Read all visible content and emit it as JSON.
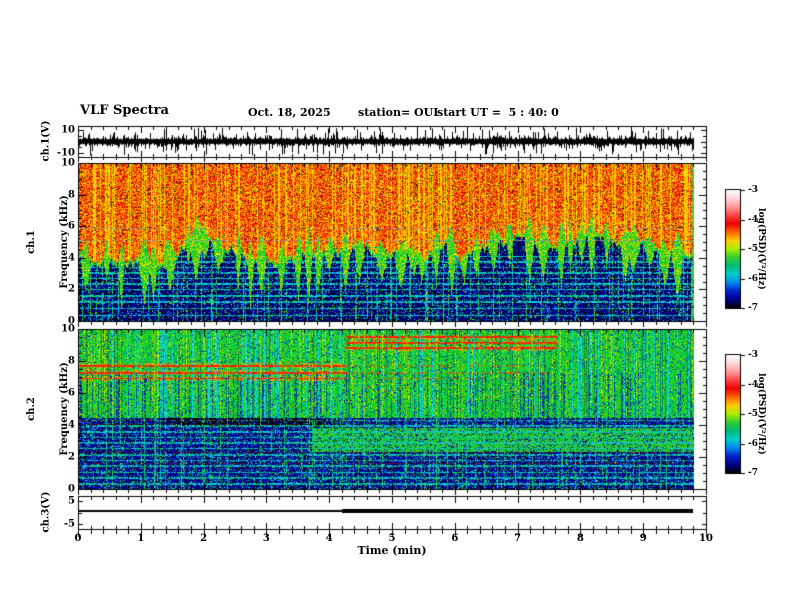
{
  "header": {
    "title": "VLF Spectra",
    "date": "Oct. 18, 2025",
    "station": "station= OUI",
    "start_ut": "start UT =  5 : 40: 0"
  },
  "time_axis": {
    "label": "Time (min)",
    "ticks": [
      "0",
      "1",
      "2",
      "3",
      "4",
      "5",
      "6",
      "7",
      "8",
      "9",
      "10"
    ],
    "range_min": [
      0,
      10
    ]
  },
  "panels": {
    "ch1_strip": {
      "ylabel": "ch.1(V)",
      "tick_labels": [
        "10",
        "-10"
      ],
      "ylim": [
        -10,
        10
      ]
    },
    "ch1_spec": {
      "ylabel_line1": "ch.1",
      "ylabel_line2": "Frequency (kHz)",
      "tick_labels": [
        "10",
        "8",
        "6",
        "4",
        "2",
        "0"
      ],
      "ylim_khz": [
        0,
        10
      ]
    },
    "ch2_spec": {
      "ylabel_line1": "ch.2",
      "ylabel_line2": "Frequency (kHz)",
      "tick_labels": [
        "10",
        "8",
        "6",
        "4",
        "2",
        "0"
      ],
      "ylim_khz": [
        0,
        10
      ]
    },
    "ch3_strip": {
      "ylabel": "ch.3(V)",
      "tick_labels": [
        "5",
        "-5"
      ],
      "ylim": [
        -5,
        5
      ]
    }
  },
  "colorbars": [
    {
      "label": "log(PSD)(V²/Hz)",
      "tick_labels": [
        "-3",
        "-4",
        "-5",
        "-6",
        "-7"
      ],
      "value_range": [
        -7,
        -3
      ],
      "gradient_top_to_bottom": [
        "#ffffff",
        "#ffd6da",
        "#ff9a9a",
        "#ff4444",
        "#ee0000",
        "#ff6600",
        "#ffcc00",
        "#aaee00",
        "#33cc33",
        "#00bb77",
        "#00cccc",
        "#0088ee",
        "#0022cc",
        "#000088",
        "#000000"
      ]
    },
    {
      "label": "log(PSD)(V²/Hz)",
      "tick_labels": [
        "-3",
        "-4",
        "-5",
        "-6",
        "-7"
      ],
      "value_range": [
        -7,
        -3
      ],
      "gradient_top_to_bottom": [
        "#ffffff",
        "#ffd6da",
        "#ff9a9a",
        "#ff4444",
        "#ee0000",
        "#ff6600",
        "#ffcc00",
        "#aaee00",
        "#33cc33",
        "#00bb77",
        "#00cccc",
        "#0088ee",
        "#0022cc",
        "#000088",
        "#000000"
      ]
    }
  ],
  "chart_data": [
    {
      "type": "line",
      "panel": "ch1_waveform",
      "ylabel": "ch.1(V)",
      "ylim": [
        -10,
        10
      ],
      "x_range_min": [
        0,
        9.8
      ],
      "description": "Dense broadband noise band of roughly ±4 V with frequent impulsive spikes reaching ±10 V over the whole 0–9.8 min record."
    },
    {
      "type": "heatmap",
      "panel": "ch1_spectrogram",
      "ylabel": "ch.1 Frequency (kHz)",
      "ylim_khz": [
        0,
        10
      ],
      "x_range_min": [
        0,
        9.8
      ],
      "value_label": "log(PSD)(V²/Hz)",
      "value_range": [
        -7,
        -3
      ],
      "intense_band_khz": [
        4.5,
        10
      ],
      "weak_band_khz": [
        0,
        4.5
      ],
      "boundary_khz": 4.5,
      "boundary_character": "jagged spiky lower edge with periodic green wedges dipping to ~2.5 kHz",
      "striation_khz": [
        0.35,
        0.8,
        1.2,
        1.6,
        2.0,
        2.35,
        2.7,
        3.05,
        3.4,
        3.75,
        4.1
      ],
      "gray_lines_khz": [
        5.15,
        5.9
      ],
      "texture": "strong vertical striping; red/orange/yellow (~ -3.5) above boundary, dark blue with cyan horizontal striations (~ -6.5) below"
    },
    {
      "type": "heatmap",
      "panel": "ch2_spectrogram",
      "ylabel": "ch.2 Frequency (kHz)",
      "ylim_khz": [
        0,
        10
      ],
      "x_range_min": [
        0,
        9.8
      ],
      "value_label": "log(PSD)(V²/Hz)",
      "value_range": [
        -7,
        -3
      ],
      "moderate_band_khz": [
        4.5,
        10
      ],
      "red_lines_first_segment": {
        "x_min": [
          0,
          4.2
        ],
        "khz": [
          6.95,
          7.3,
          7.75
        ]
      },
      "red_lines_mid_segment": {
        "x_min": [
          4.2,
          7.6
        ],
        "khz": [
          8.85,
          9.2,
          9.55
        ]
      },
      "green_band": {
        "x_min": [
          3.7,
          9.8
        ],
        "khz": [
          2.35,
          3.85
        ]
      },
      "dark_band": {
        "x_min": [
          1.3,
          3.9
        ],
        "khz": [
          3.9,
          4.45
        ]
      },
      "striation_khz": [
        0.3,
        0.7,
        1.05,
        1.45,
        1.8,
        2.15,
        2.55,
        2.9,
        3.25,
        3.6,
        3.95,
        4.3
      ],
      "maroon_lines_khz": [
        4.3,
        4.05,
        2.3,
        1.6
      ],
      "texture": "green field with dark-blue vertical streaks above 4.5 kHz, red horizontal interference lines, dark blue with cyan/green horizontal striations below 4.5 kHz"
    },
    {
      "type": "line",
      "panel": "ch3_level",
      "ylabel": "ch.3(V)",
      "ylim": [
        -5,
        5
      ],
      "segments": [
        {
          "x_min": [
            0,
            4.2
          ],
          "level_v": 0.5,
          "stroke": "thin"
        },
        {
          "x_min": [
            4.2,
            9.8
          ],
          "level_v": 0.5,
          "stroke": "thick"
        }
      ]
    }
  ]
}
